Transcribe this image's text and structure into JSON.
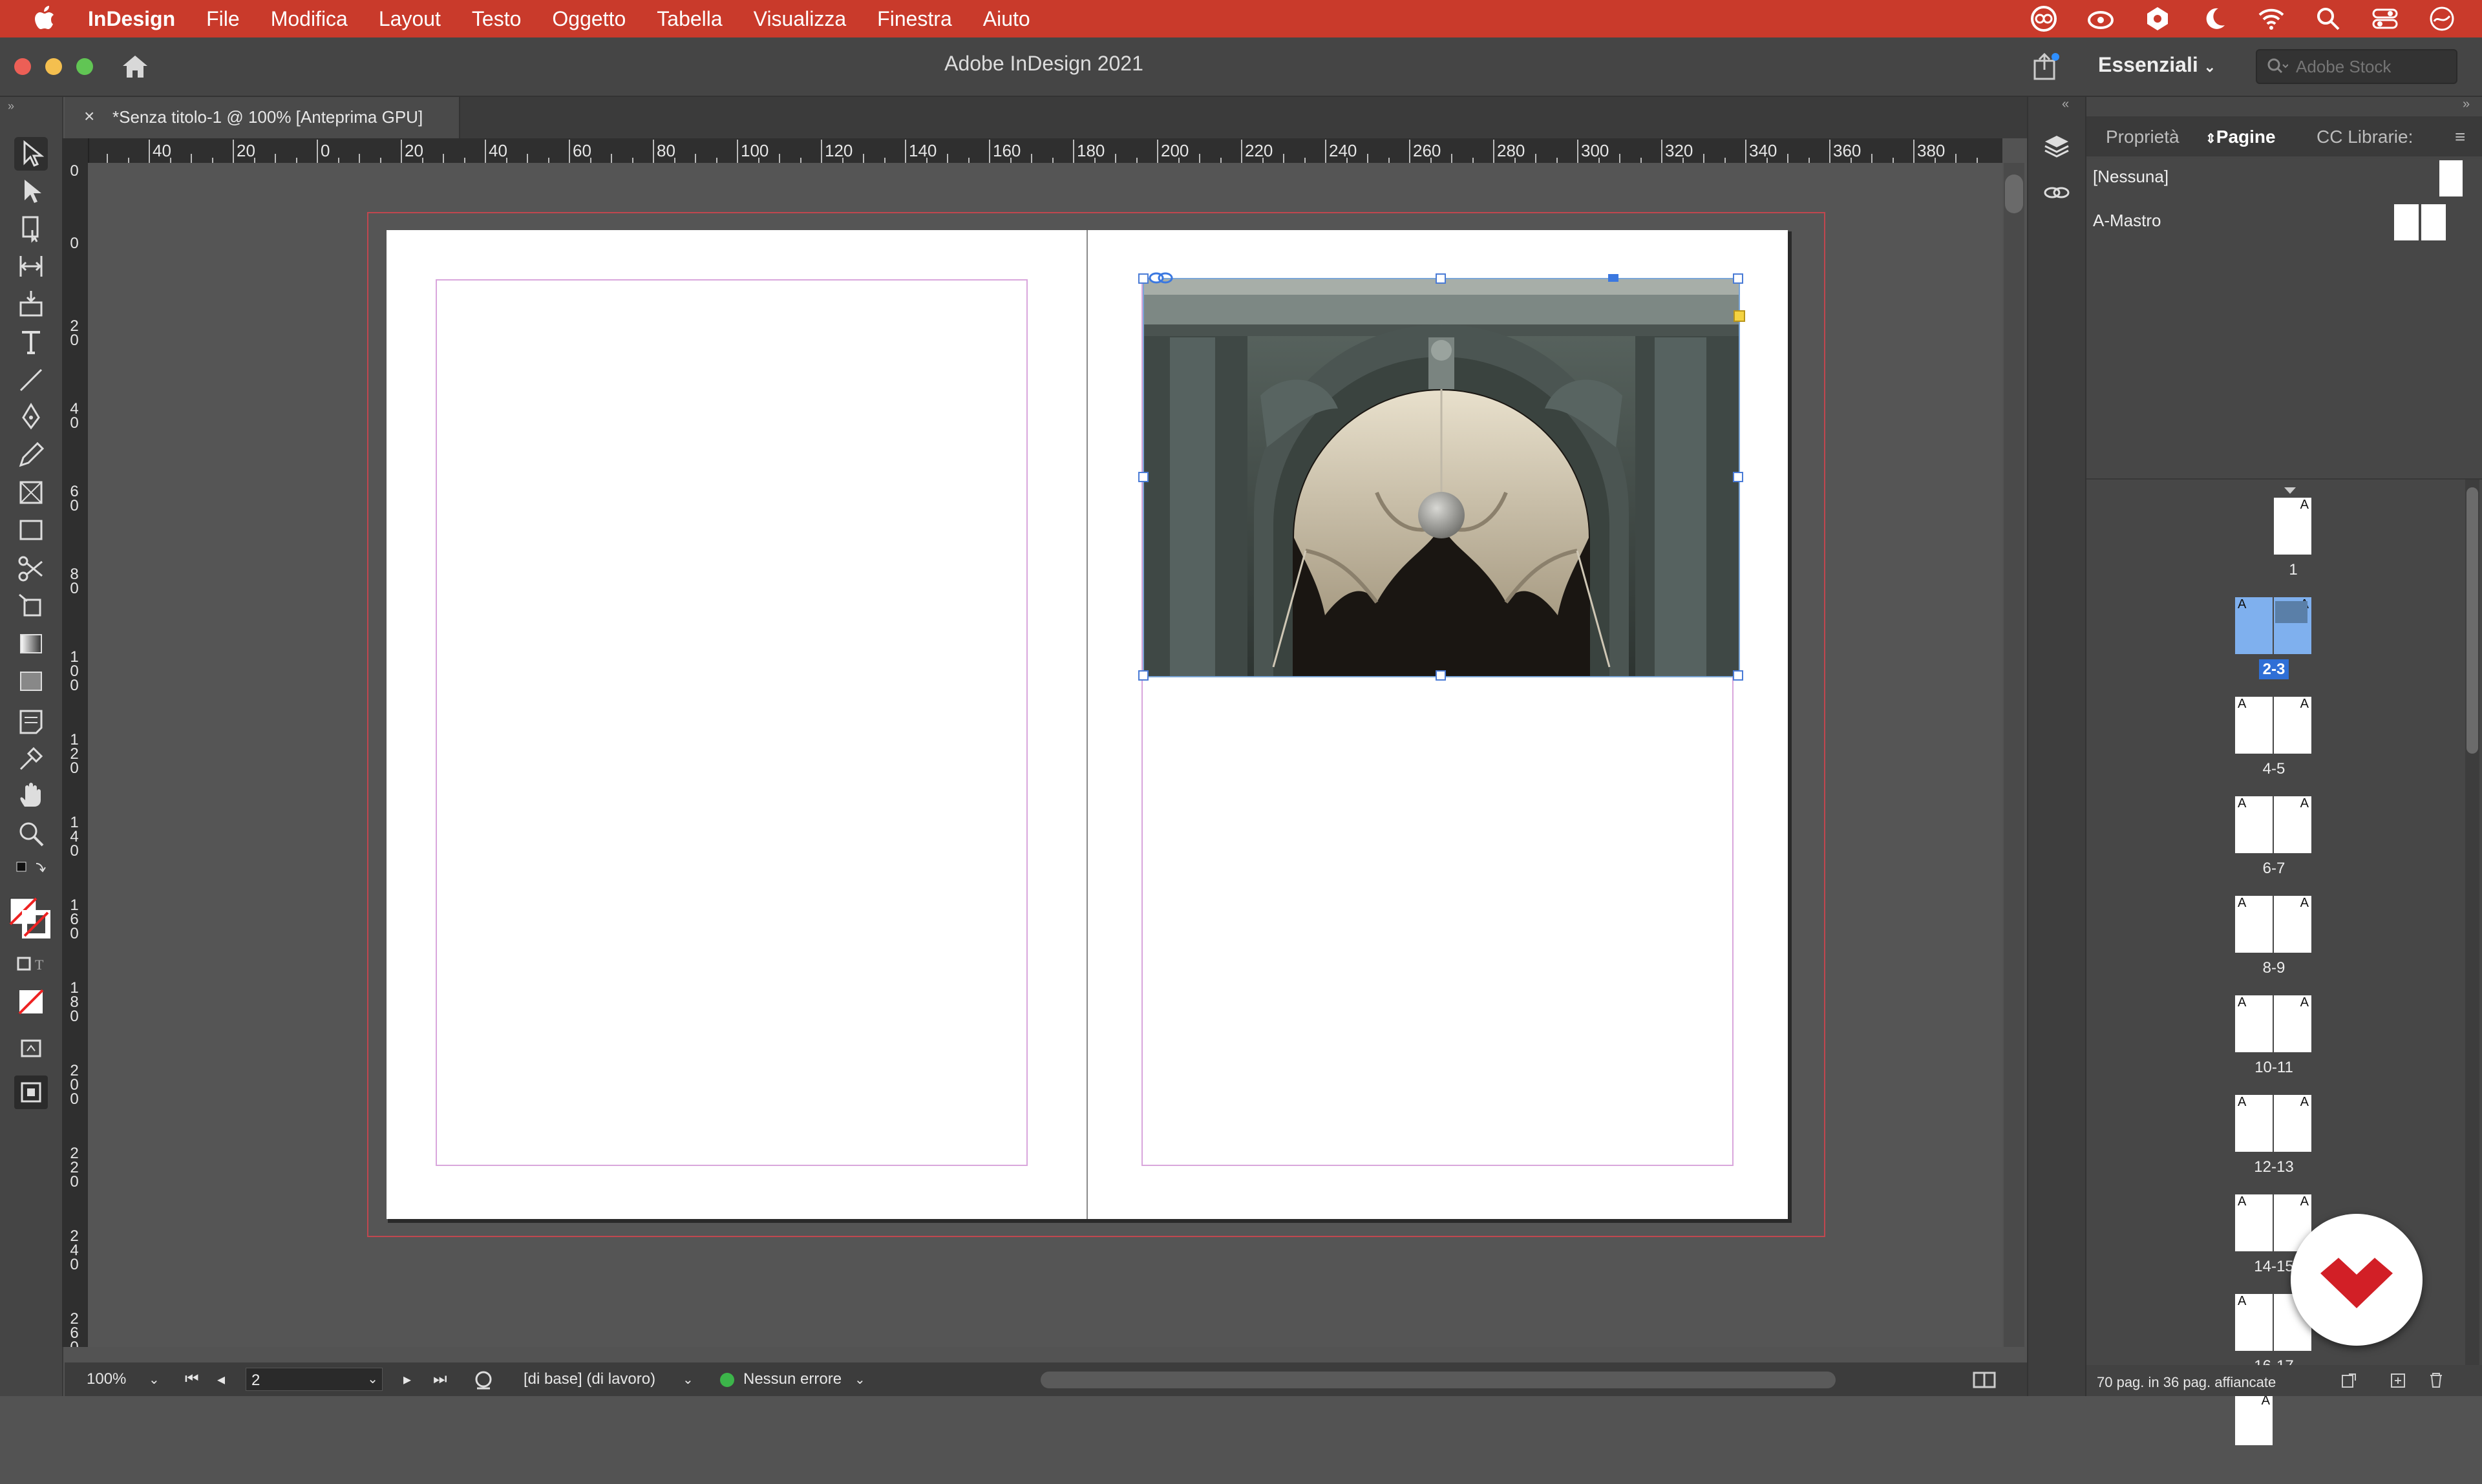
{
  "menubar": {
    "app_name": "InDesign",
    "items": [
      "File",
      "Modifica",
      "Layout",
      "Testo",
      "Oggetto",
      "Tabella",
      "Visualizza",
      "Finestra",
      "Aiuto"
    ]
  },
  "titlebar": {
    "title": "Adobe InDesign 2021",
    "workspace": "Essenziali",
    "search_placeholder": "Adobe Stock"
  },
  "document": {
    "tab_title": "*Senza titolo-1 @ 100% [Anteprima GPU]",
    "close_glyph": "×"
  },
  "rulers": {
    "horizontal": [
      "60",
      "40",
      "20",
      "0",
      "20",
      "40",
      "60",
      "80",
      "100",
      "120",
      "140",
      "160",
      "180",
      "200",
      "220",
      "240",
      "260",
      "280",
      "300",
      "320",
      "340",
      "360",
      "380"
    ],
    "vertical": [
      "0",
      "0",
      "20",
      "40",
      "60",
      "80",
      "100",
      "120",
      "140",
      "160",
      "180",
      "200",
      "220",
      "240",
      "260"
    ]
  },
  "statusbar": {
    "zoom": "100%",
    "page": "2",
    "style": "[di base] (di lavoro)",
    "preflight": "Nessun errore"
  },
  "panel": {
    "tabs": [
      "Proprietà",
      "Pagine",
      "CC Librarie:"
    ],
    "active_tab": "Pagine",
    "masters": [
      "[Nessuna]",
      "A-Mastro"
    ],
    "spreads": [
      {
        "label": "1",
        "pages": 1
      },
      {
        "label": "2-3",
        "pages": 2,
        "selected": true
      },
      {
        "label": "4-5",
        "pages": 2
      },
      {
        "label": "6-7",
        "pages": 2
      },
      {
        "label": "8-9",
        "pages": 2
      },
      {
        "label": "10-11",
        "pages": 2
      },
      {
        "label": "12-13",
        "pages": 2
      },
      {
        "label": "14-15",
        "pages": 2
      },
      {
        "label": "16-17",
        "pages": 2
      },
      {
        "label": "",
        "pages": 1
      }
    ],
    "master_marker": "A",
    "footer": "70 pag. in 36 pag. affiancate"
  },
  "colors": {
    "menubar": "#c93a2b",
    "selection": "#2f6fd6",
    "margin_guide": "#d9a6dc",
    "bleed_guide": "#c0474f"
  }
}
